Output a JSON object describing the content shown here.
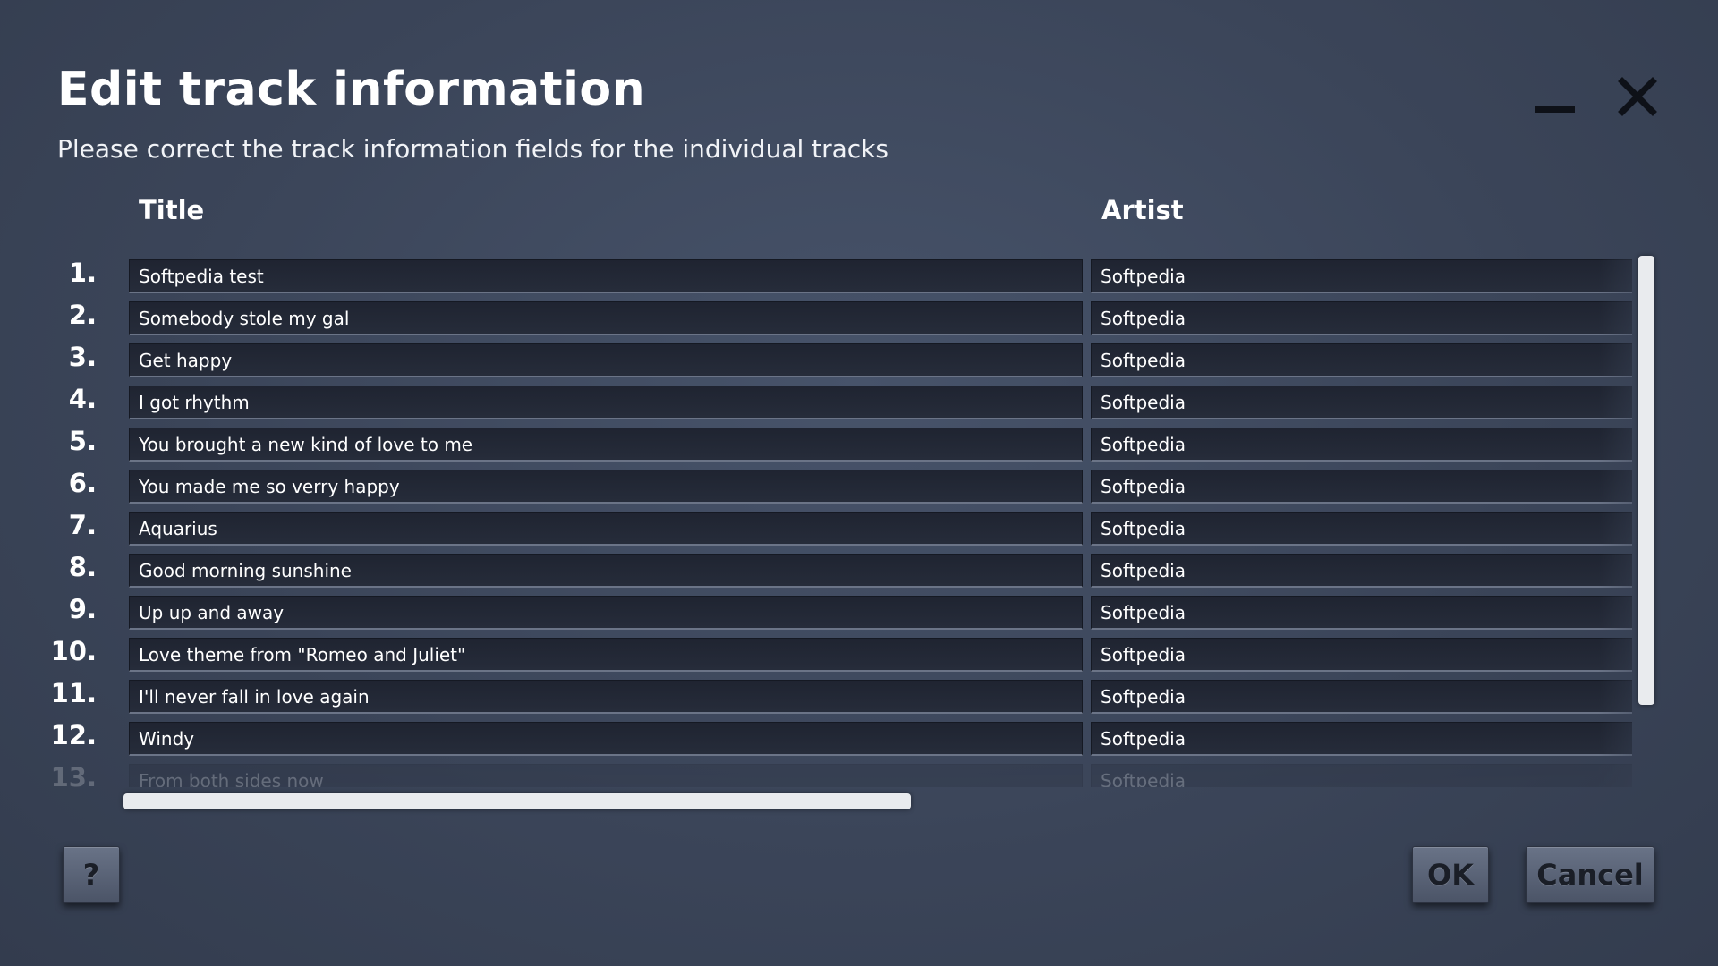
{
  "dialog": {
    "title": "Edit track information",
    "subtitle": "Please correct the track information fields for the individual tracks"
  },
  "columns": {
    "title": "Title",
    "artist": "Artist"
  },
  "tracks": [
    {
      "num": "1.",
      "title": "Softpedia test",
      "artist": "Softpedia"
    },
    {
      "num": "2.",
      "title": "Somebody stole my gal",
      "artist": "Softpedia"
    },
    {
      "num": "3.",
      "title": "Get happy",
      "artist": "Softpedia"
    },
    {
      "num": "4.",
      "title": "I got rhythm",
      "artist": "Softpedia"
    },
    {
      "num": "5.",
      "title": "You brought a new kind of love to me",
      "artist": "Softpedia"
    },
    {
      "num": "6.",
      "title": "You made me so verry happy",
      "artist": "Softpedia"
    },
    {
      "num": "7.",
      "title": "Aquarius",
      "artist": "Softpedia"
    },
    {
      "num": "8.",
      "title": "Good morning sunshine",
      "artist": "Softpedia"
    },
    {
      "num": "9.",
      "title": "Up up and away",
      "artist": "Softpedia"
    },
    {
      "num": "10.",
      "title": "Love theme from \"Romeo and Juliet\"",
      "artist": "Softpedia"
    },
    {
      "num": "11.",
      "title": "I'll never fall in love again",
      "artist": "Softpedia"
    },
    {
      "num": "12.",
      "title": "Windy",
      "artist": "Softpedia"
    },
    {
      "num": "13.",
      "title": "From both sides now",
      "artist": "Softpedia"
    }
  ],
  "buttons": {
    "help": "?",
    "ok": "OK",
    "cancel": "Cancel"
  },
  "icons": {
    "minimize": "minimize-icon",
    "close": "close-icon"
  }
}
